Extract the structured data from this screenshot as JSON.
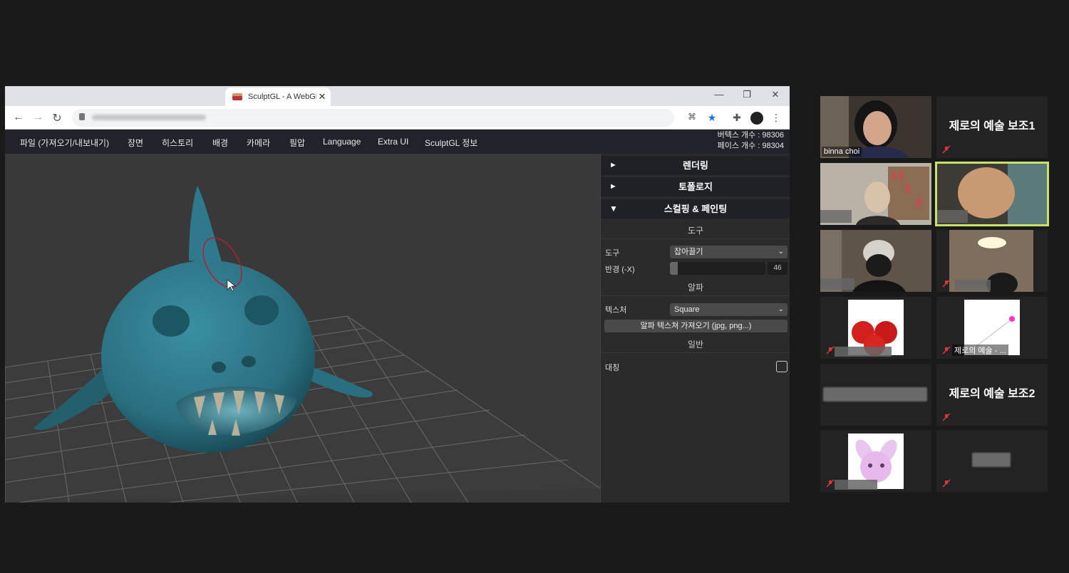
{
  "browser": {
    "tab_title": "SculptGL - A WebGL",
    "tab_close": "✕"
  },
  "app": {
    "menu": [
      "파일 (가져오기/내보내기)",
      "장면",
      "히스토리",
      "배경",
      "카메라",
      "필압",
      "Language",
      "Extra UI",
      "SculptGL 정보"
    ],
    "vertex_count": "버텍스 개수 : 98306",
    "face_count": "페이스 개수 : 98304"
  },
  "panel": {
    "sections": {
      "rendering": "렌더링",
      "topology": "토폴로지",
      "sculpting": "스컬핑 & 페인팅"
    },
    "tool_header": "도구",
    "tool_label": "도구",
    "tool_value": "잡아끌기",
    "radius_label": "반경 (-X)",
    "radius_value": "46",
    "radius_fraction": 0.08,
    "alpha_header": "알파",
    "texture_label": "텍스처",
    "texture_value": "Square",
    "import_alpha_button": "알파 텍스쳐 가져오기 (jpg, png...)",
    "general_header": "일반",
    "symmetry_label": "대칭"
  },
  "zoom": {
    "participants": [
      {
        "name": "binna choi"
      },
      {
        "name": "제로의 예술 보조1"
      },
      {
        "name": "제로의 예술 - ..."
      },
      {
        "name": "제로의 예술 보조2"
      }
    ]
  },
  "colors": {
    "active_speaker": "#c6e26a",
    "mute_red": "#e0343a",
    "model_teal": "#2f7d8f",
    "brush_ring": "#b02030"
  }
}
